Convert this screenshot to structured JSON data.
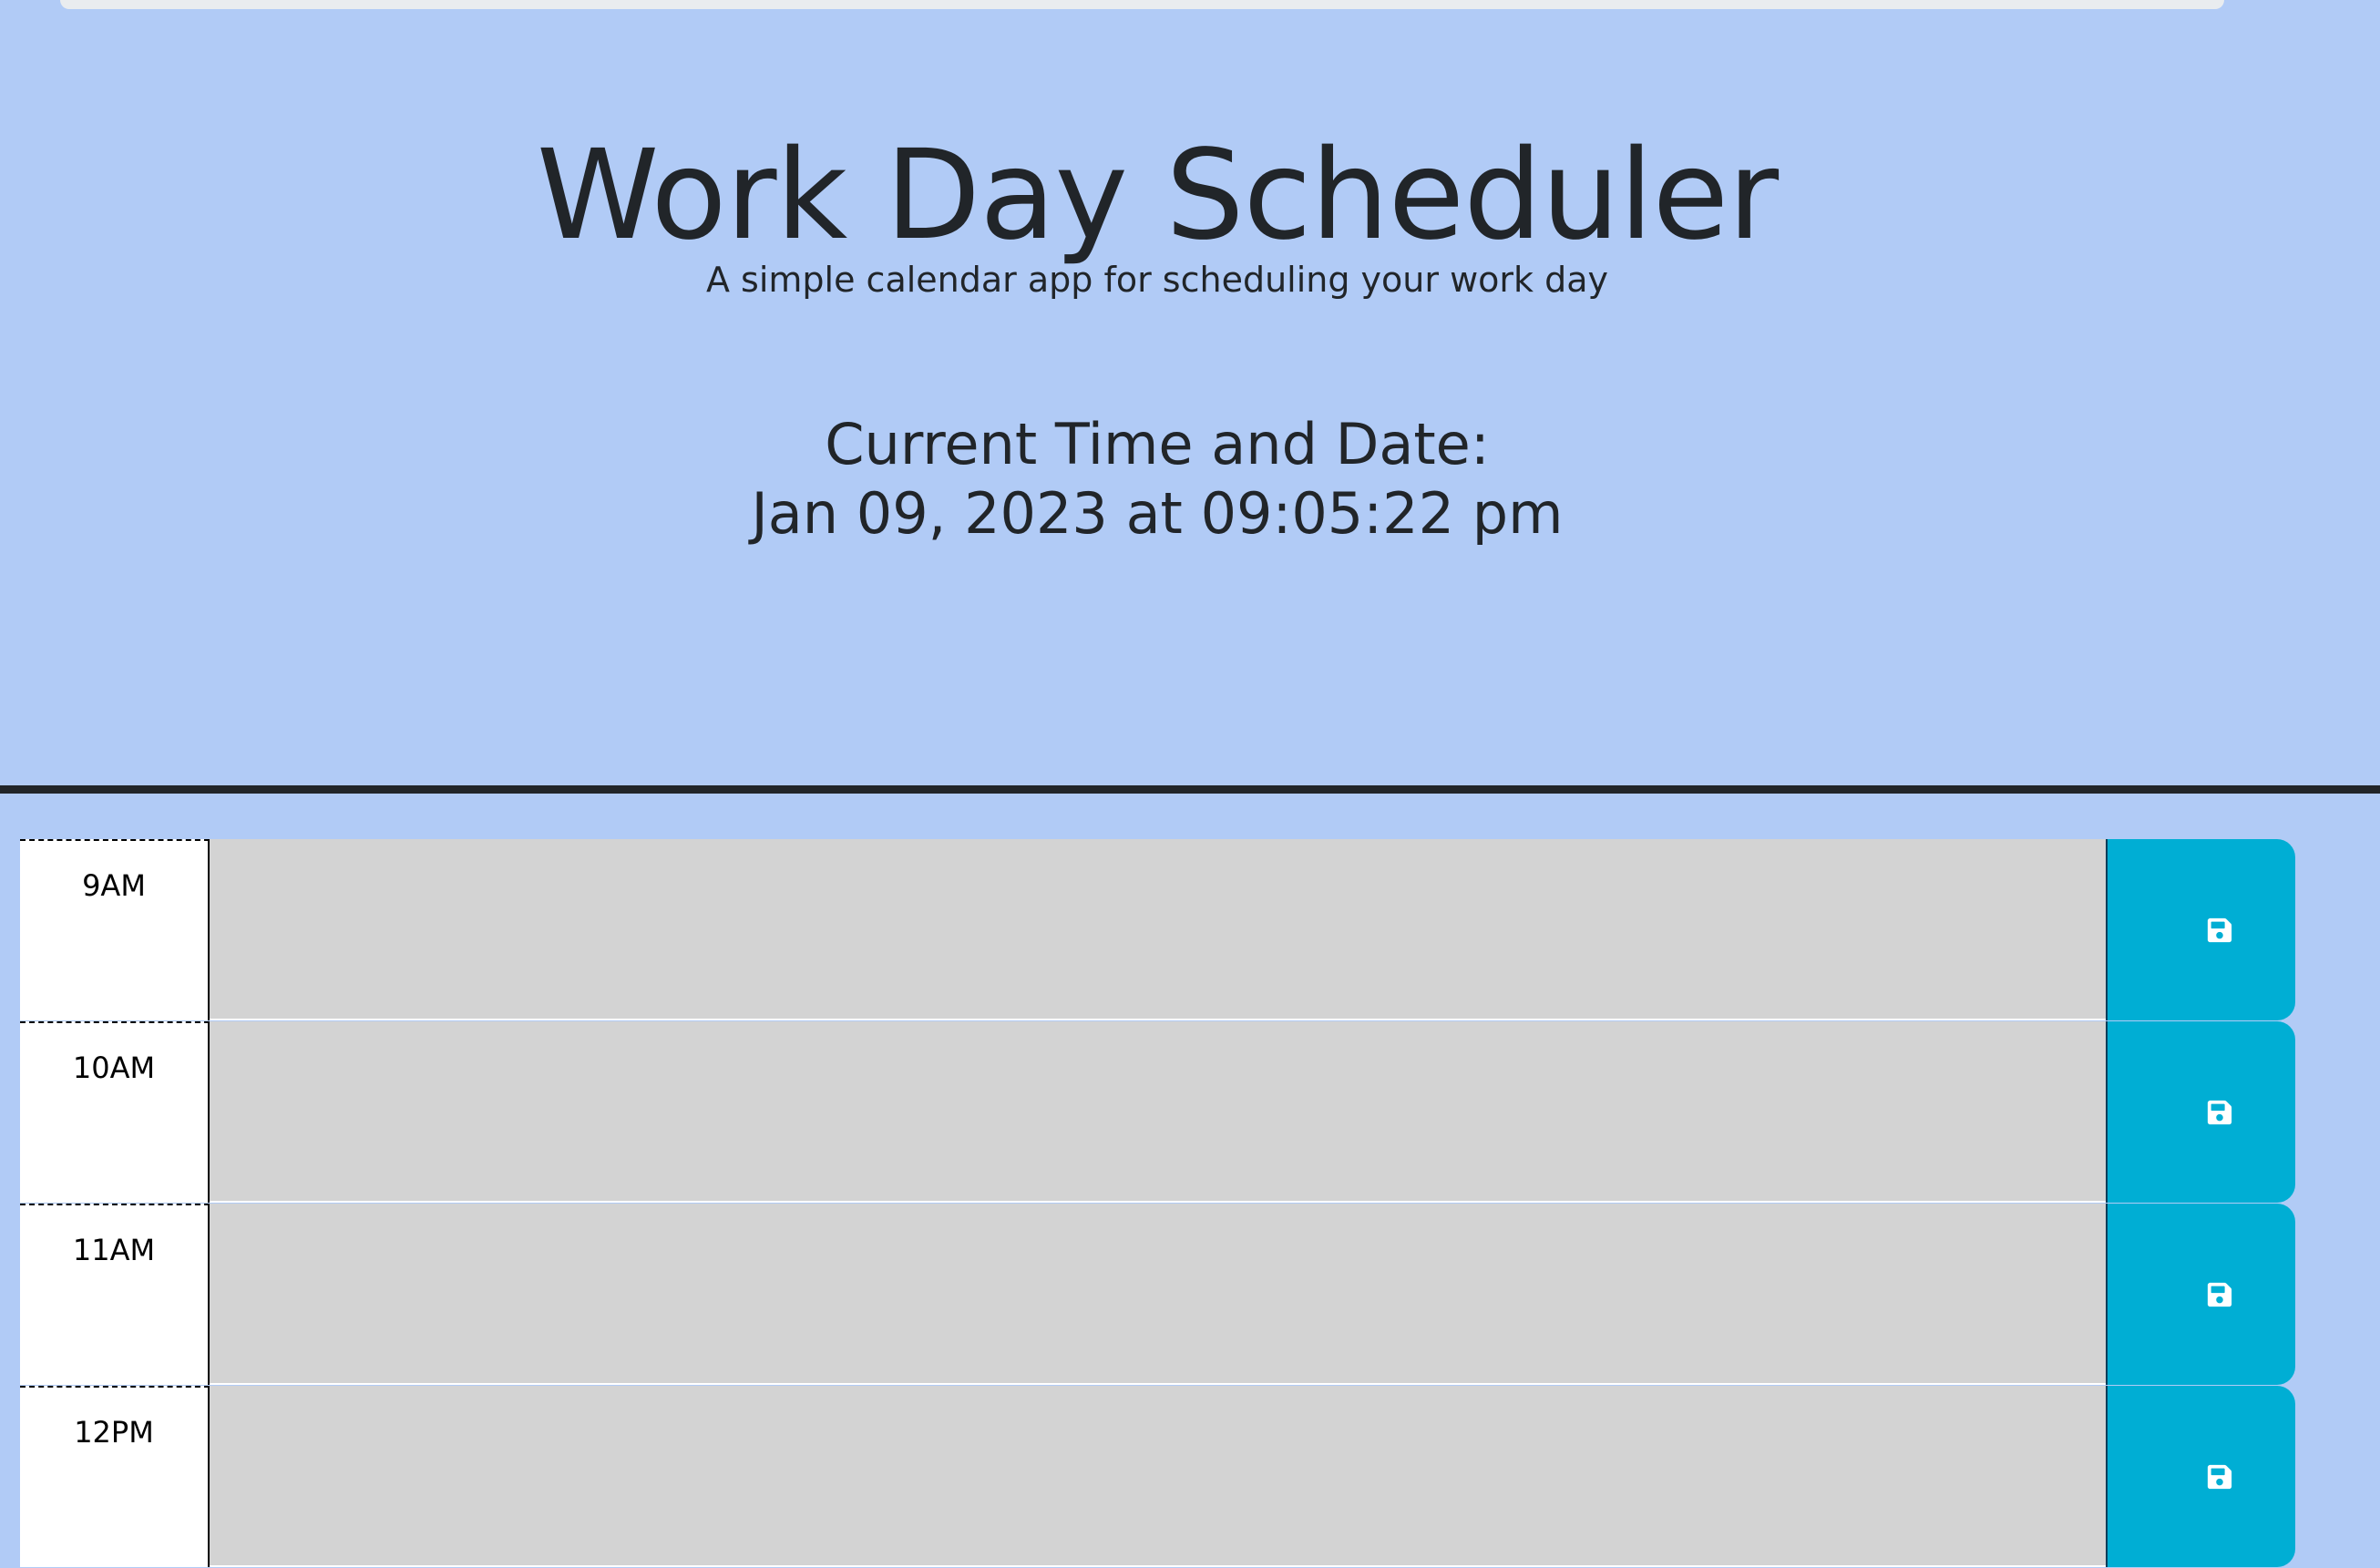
{
  "header": {
    "title": "Work Day Scheduler",
    "lead": "A simple calendar app for scheduling your work day",
    "clock_label": "Current Time and Date:",
    "clock_value": "Jan 09, 2023 at 09:05:22 pm"
  },
  "timeblocks": [
    {
      "hour": "9AM",
      "text": ""
    },
    {
      "hour": "10AM",
      "text": ""
    },
    {
      "hour": "11AM",
      "text": ""
    },
    {
      "hour": "12PM",
      "text": ""
    }
  ],
  "icons": {
    "save": "save-icon"
  },
  "colors": {
    "background": "#b1cbf6",
    "past": "#d3d3d3",
    "save_button": "#00aed4",
    "text": "#212529"
  }
}
